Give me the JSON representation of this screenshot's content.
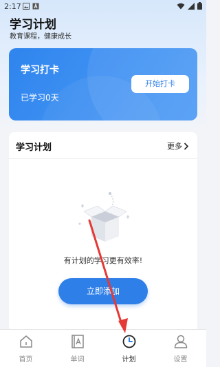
{
  "status_bar": {
    "time": "2:17",
    "icons": [
      "image-icon",
      "font-icon",
      "wifi-icon",
      "signal-icon",
      "battery-icon"
    ]
  },
  "header": {
    "title": "学习计划",
    "subtitle": "教育课程，健康成长"
  },
  "checkin_card": {
    "title": "学习打卡",
    "days_text": "已学习0天",
    "button_label": "开始打卡"
  },
  "plan_card": {
    "title": "学习计划",
    "more_label": "更多",
    "empty_text": "有计划的学习更有效率!",
    "add_button_label": "立即添加"
  },
  "bottom_nav": {
    "items": [
      {
        "label": "首页",
        "icon": "home-icon"
      },
      {
        "label": "单词",
        "icon": "word-book-icon"
      },
      {
        "label": "计划",
        "icon": "clock-icon"
      },
      {
        "label": "设置",
        "icon": "user-icon"
      }
    ],
    "active_index": 2
  },
  "colors": {
    "accent": "#2f7fe8",
    "annotation_arrow": "#e53935"
  }
}
